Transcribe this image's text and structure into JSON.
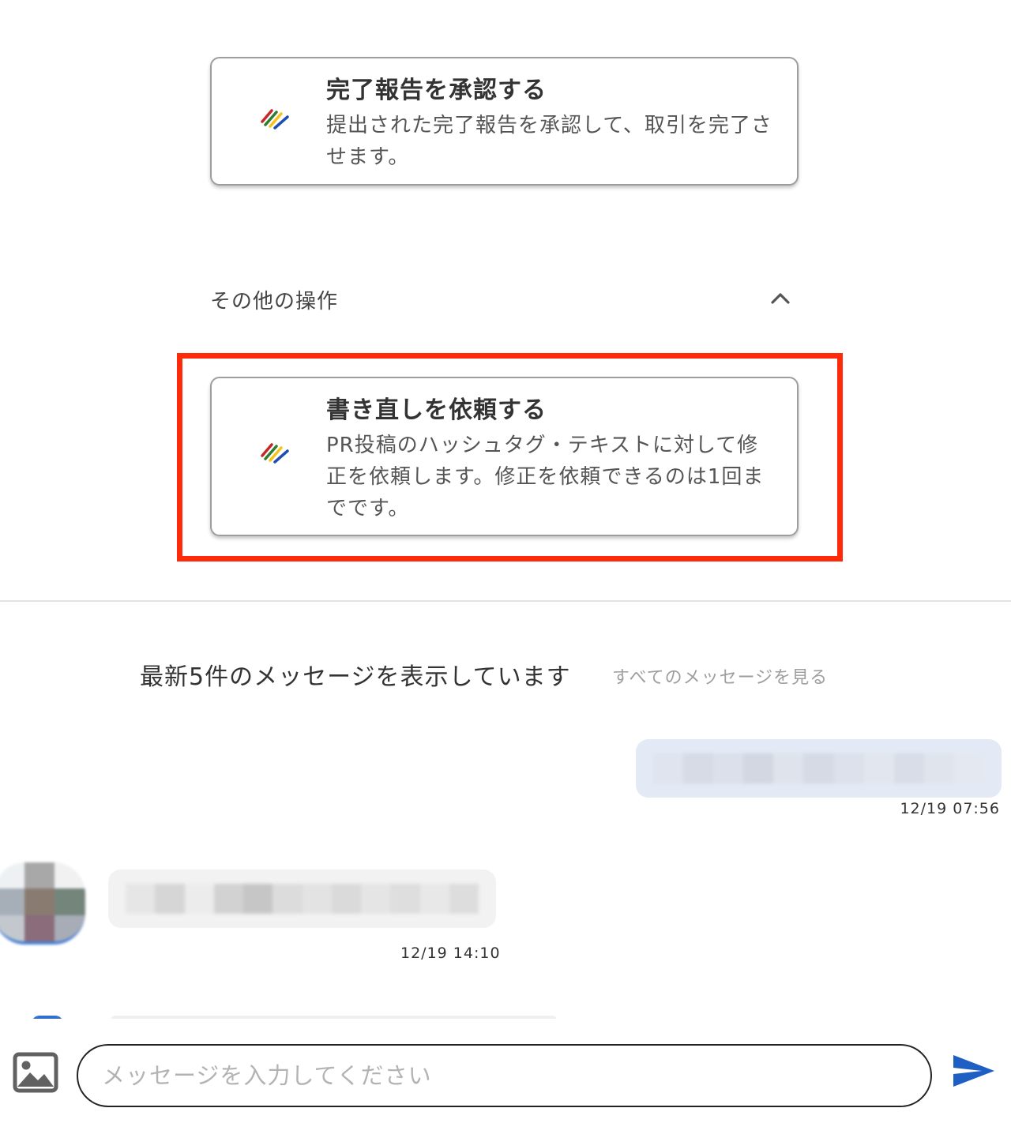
{
  "approve_card": {
    "title": "完了報告を承認する",
    "description": "提出された完了報告を承認して、取引を完了させます。",
    "logo_icon": "brand-stripes-icon"
  },
  "other_ops": {
    "label": "その他の操作",
    "toggle_icon": "chevron-up-icon"
  },
  "rewrite_card": {
    "title": "書き直しを依頼する",
    "description": "PR投稿のハッシュタグ・テキストに対して修正を依頼します。修正を依頼できるのは1回までです。",
    "logo_icon": "brand-stripes-icon",
    "highlight_color": "#ff2a0a"
  },
  "messages": {
    "header": "最新5件のメッセージを表示しています",
    "see_all_link": "すべてのメッセージを見る",
    "items": [
      {
        "direction": "outgoing",
        "content_blurred": true,
        "time": "12/19 07:56",
        "bubble_color": "#e3eaf5"
      },
      {
        "direction": "incoming",
        "content_blurred": true,
        "time": "12/19 14:10",
        "bubble_color": "#f2f2f2",
        "avatar_icon": "avatar-blurred"
      }
    ]
  },
  "composer": {
    "placeholder": "メッセージを入力してください",
    "value": "",
    "image_icon": "image-icon",
    "send_icon": "send-icon",
    "send_color": "#1f5fc4"
  }
}
